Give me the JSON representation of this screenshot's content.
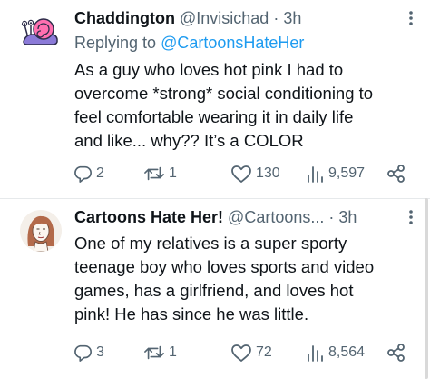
{
  "tweets": [
    {
      "name": "Chaddington",
      "handle": "@Invisichad",
      "dot": "·",
      "time": "3h",
      "replying_prefix": "Replying to ",
      "replying_handle": "@CartoonsHateHer",
      "text": "As a guy who loves hot pink I had to\novercome *strong* social conditioning to\nfeel comfortable wearing it in daily life\nand like... why?? It’s a COLOR",
      "replies": "2",
      "retweets": "1",
      "likes": "130",
      "views": "9,597"
    },
    {
      "name": "Cartoons Hate Her!",
      "handle": "@Cartoons...",
      "dot": "·",
      "time": "3h",
      "text": "One of my relatives is a super sporty\nteenage boy who loves sports and video\ngames, has a girlfriend, and loves hot\npink! He has since he was little.",
      "replies": "3",
      "retweets": "1",
      "likes": "72",
      "views": "8,564"
    }
  ],
  "colors": {
    "text": "#0f1419",
    "secondary": "#536471",
    "link": "#1d9bf0",
    "divider": "#e6e9eb"
  },
  "icons": [
    "snail-avatar",
    "person-drawing-avatar",
    "more-icon",
    "reply-icon",
    "retweet-icon",
    "like-icon",
    "views-icon",
    "share-icon"
  ]
}
